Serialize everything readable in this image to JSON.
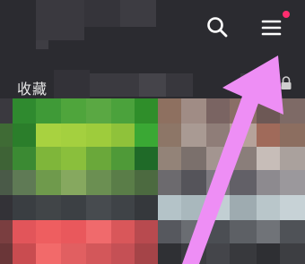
{
  "header": {
    "search_icon": "search-icon",
    "menu_icon": "menu-icon",
    "notification_color": "#ff2d6f"
  },
  "tabs": {
    "first_label": "收藏",
    "lock_icon": "lock-icon"
  },
  "annotation": {
    "arrow_color": "#ee8ef5",
    "points_to": "menu-icon"
  },
  "colors": {
    "background": "#2b2b30",
    "icon": "#ffffff"
  }
}
